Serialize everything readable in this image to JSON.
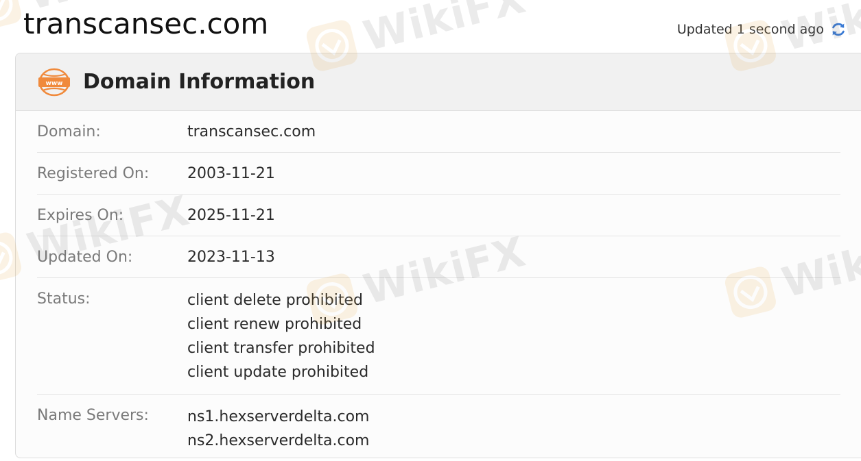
{
  "header": {
    "domain_title": "transcansec.com",
    "updated_text": "Updated 1 second ago",
    "refresh_icon": "refresh-icon"
  },
  "card": {
    "title": "Domain Information",
    "icon": "www-icon",
    "icon_text": "www",
    "rows": [
      {
        "label": "Domain:",
        "values": [
          "transcansec.com"
        ]
      },
      {
        "label": "Registered On:",
        "values": [
          "2003-11-21"
        ]
      },
      {
        "label": "Expires On:",
        "values": [
          "2025-11-21"
        ]
      },
      {
        "label": "Updated On:",
        "values": [
          "2023-11-13"
        ]
      },
      {
        "label": "Status:",
        "values": [
          "client delete prohibited",
          "client renew prohibited",
          "client transfer prohibited",
          "client update prohibited"
        ]
      },
      {
        "label": "Name Servers:",
        "values": [
          "ns1.hexserverdelta.com",
          "ns2.hexserverdelta.com"
        ]
      }
    ]
  },
  "watermark": {
    "text": "WikiFX"
  },
  "colors": {
    "accent_orange": "#f08a3c",
    "refresh_blue": "#3a7bd5",
    "label_gray": "#7a7a7a",
    "header_bg": "#f1f1f1"
  }
}
